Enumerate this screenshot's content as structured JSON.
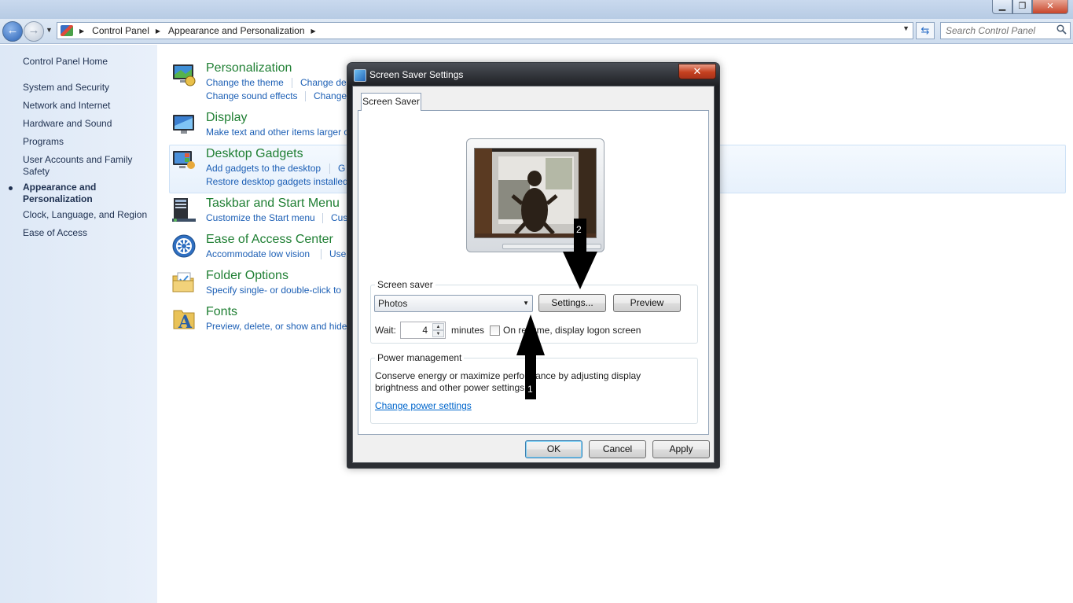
{
  "window": {
    "min_glyph": "▁",
    "max_glyph": "❐",
    "close_glyph": "✕"
  },
  "address": {
    "crumbs": [
      "Control Panel",
      "Appearance and Personalization"
    ],
    "search_placeholder": "Search Control Panel"
  },
  "leftnav": {
    "home": "Control Panel Home",
    "items": [
      "System and Security",
      "Network and Internet",
      "Hardware and Sound",
      "Programs",
      "User Accounts and Family Safety",
      "Appearance and Personalization",
      "Clock, Language, and Region",
      "Ease of Access"
    ],
    "current": "Appearance and Personalization"
  },
  "categories": [
    {
      "title": "Personalization",
      "icon": "personalization-icon",
      "links": [
        [
          "Change the theme",
          "Change de"
        ],
        [
          "Change sound effects",
          "Change"
        ]
      ]
    },
    {
      "title": "Display",
      "icon": "display-icon",
      "links": [
        [
          "Make text and other items larger o"
        ]
      ]
    },
    {
      "title": "Desktop Gadgets",
      "icon": "gadgets-icon",
      "links": [
        [
          "Add gadgets to the desktop",
          "G"
        ],
        [
          "Restore desktop gadgets installed"
        ]
      ]
    },
    {
      "title": "Taskbar and Start Menu",
      "icon": "taskbar-icon",
      "links": [
        [
          "Customize the Start menu",
          "Cus"
        ]
      ]
    },
    {
      "title": "Ease of Access Center",
      "icon": "ease-of-access-icon",
      "links": [
        [
          "Accommodate low vision",
          "Use"
        ]
      ]
    },
    {
      "title": "Folder Options",
      "icon": "folder-icon",
      "links": [
        [
          "Specify single- or double-click to"
        ]
      ]
    },
    {
      "title": "Fonts",
      "icon": "fonts-icon",
      "links": [
        [
          "Preview, delete, or show and hide"
        ]
      ]
    }
  ],
  "dialog": {
    "title": "Screen Saver Settings",
    "close_glyph": "✕",
    "tab": "Screen Saver",
    "screensaver_group": "Screen saver",
    "screensaver_selected": "Photos",
    "settings_button": "Settings...",
    "preview_button": "Preview",
    "wait_label": "Wait:",
    "wait_value": "4",
    "minutes_label": "minutes",
    "resume_label": "On resume, display logon screen",
    "resume_checked": false,
    "power_group": "Power management",
    "power_text_1": "Conserve energy or maximize performance by adjusting display",
    "power_text_2": "brightness and other power settings.",
    "power_link": "Change power settings",
    "ok": "OK",
    "cancel": "Cancel",
    "apply": "Apply"
  },
  "annotations": {
    "arrow_1": "1",
    "arrow_2": "2"
  }
}
